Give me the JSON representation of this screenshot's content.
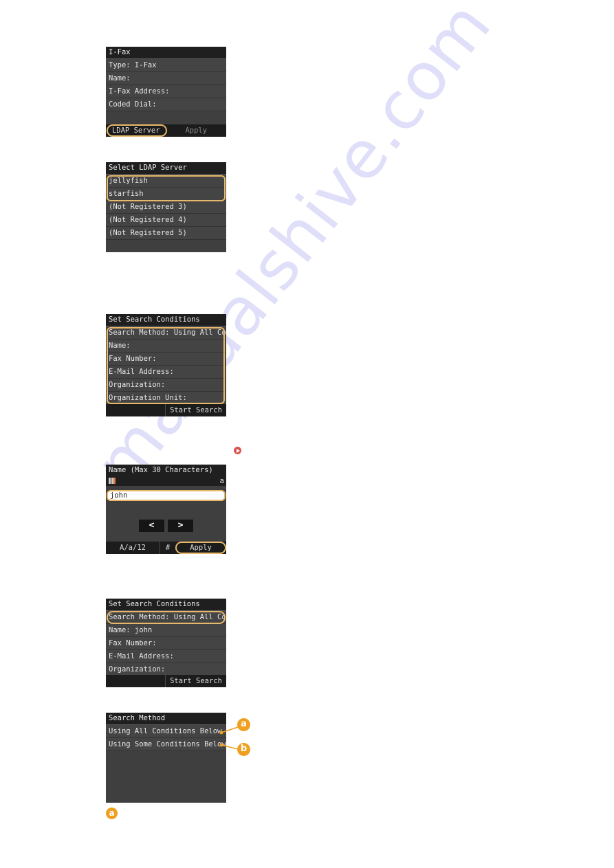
{
  "watermark": "manualshive.com",
  "accent_color": "#e8b86a",
  "badge_color": "#f0a020",
  "screen1": {
    "title": "I-Fax",
    "rows": [
      "Type: I-Fax",
      "Name:",
      "I-Fax Address:",
      "Coded Dial:"
    ],
    "buttons": [
      "LDAP Server",
      "Apply"
    ]
  },
  "screen2": {
    "title": "Select LDAP Server",
    "rows": [
      "jellyfish",
      "starfish",
      "(Not Registered 3)",
      "(Not Registered 4)",
      "(Not Registered 5)"
    ]
  },
  "screen3": {
    "title": "Set Search Conditions",
    "rows": [
      "Search Method: Using All Condi",
      "Name:",
      "Fax Number:",
      "E-Mail Address:",
      "Organization:",
      "Organization Unit:"
    ],
    "buttons": [
      "Start Search"
    ]
  },
  "screen4": {
    "title": "Name (Max 30 Characters)",
    "mode_indicator": "a",
    "input_value": "john",
    "nav_left": "<",
    "nav_right": ">",
    "buttons": [
      "A/a/12",
      "#",
      "Apply"
    ]
  },
  "screen5": {
    "title": "Set Search Conditions",
    "rows": [
      "Search Method: Using All Condi",
      "Name: john",
      "Fax Number:",
      "E-Mail Address:",
      "Organization:"
    ],
    "buttons": [
      "Start Search"
    ]
  },
  "screen6": {
    "title": "Search Method",
    "rows": [
      "Using All Conditions Below",
      "Using Some Conditions Below"
    ],
    "callouts": [
      "a",
      "b"
    ]
  },
  "footnote_badge": "a"
}
